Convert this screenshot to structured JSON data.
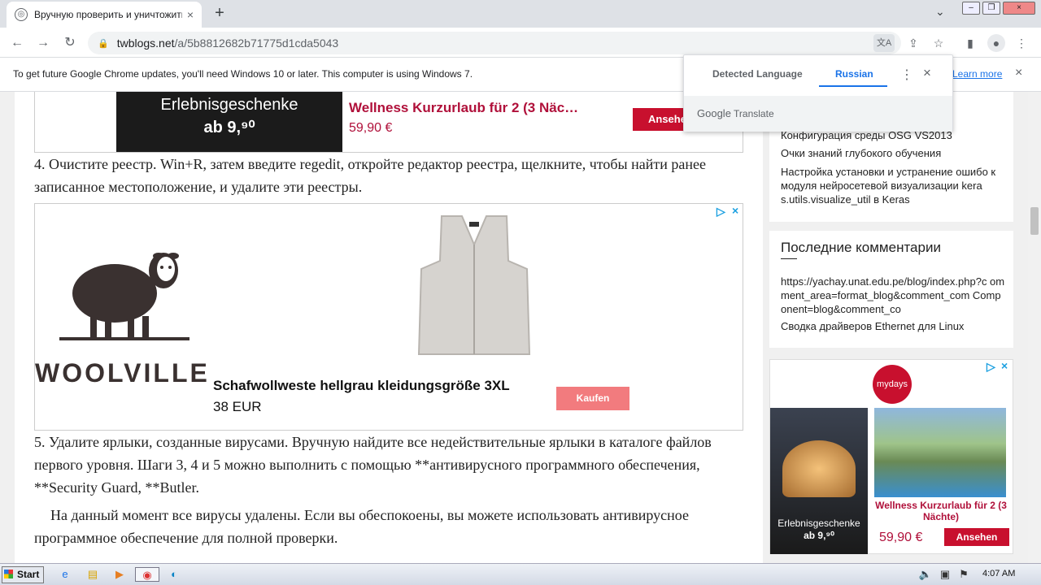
{
  "browser": {
    "tab_title": "Вручную проверить и уничтожить",
    "tab_close": "×",
    "new_tab": "+",
    "tab_search": "⌄",
    "window_buttons": [
      "–",
      "❐",
      "×"
    ],
    "nav": {
      "back": "←",
      "forward": "→",
      "reload": "↻"
    },
    "url_host": "twblogs.net",
    "url_path": "/a/5b8812682b71775d1cda5043",
    "lock": "🔒"
  },
  "infobar": {
    "message": "To get future Google Chrome updates, you'll need Windows 10 or later. This computer is using Windows 7.",
    "learn_more": "Learn more",
    "close": "×"
  },
  "translate_popup": {
    "detected": "Detected Language",
    "russian": "Russian",
    "menu": "⋮",
    "close": "×",
    "footer_google": "Google",
    "footer_translate": " Translate"
  },
  "ad_top": {
    "image_line1": "Erlebnisgeschenke",
    "image_line2": "ab 9,⁹⁰",
    "title": "Wellness Kurzurlaub für 2 (3 Näc…",
    "price": "59,90 €",
    "button": "Ansehen"
  },
  "article": {
    "step4": "4. Очистите реестр. Win+R, затем введите regedit, откройте редактор реестра, щелкните, чтобы найти ранее записанное местоположение, и удалите эти реестры.",
    "step5": "5. Удалите ярлыки, созданные вирусами. Вручную найдите все недействительные ярлыки в каталоге файлов первого уровня. Шаги 3, 4 и 5 можно выполнить с помощью **антивирусного программного обеспечения, **Security Guard, **Butler.",
    "closing": "На данный момент все вирусы удалены. Если вы обеспокоены, вы можете использовать антивирусное программное обеспечение для полной проверки."
  },
  "ad_wool": {
    "brand": "WOOLVILLE",
    "title": "Schafwollweste hellgrau kleidungsgröße 3XL",
    "price": "38 EUR",
    "button": "Kaufen"
  },
  "sidebar": {
    "recent_posts": [
      "Конфигурация среды OSG VS2013",
      "Очки знаний глубокого обучения",
      "Настройка установки и устранение ошибо к модуля нейросетевой визуализации kera s.utils.visualize_util в Keras"
    ],
    "comments_title": "Последние комментарии",
    "comments": [
      "https://yachay.unat.edu.pe/blog/index.php?c omment_area=format_blog&comment_com Component=blog&comment_co",
      "Сводка драйверов Ethernet для Linux"
    ],
    "ad": {
      "logo": "mydays",
      "image_line1": "Erlebnisgeschenke",
      "image_line2": "ab 9,⁹⁰",
      "title": "Wellness Kurzurlaub für 2 (3 Nächte)",
      "price": "59,90 €",
      "button": "Ansehen"
    }
  },
  "taskbar": {
    "start": "Start",
    "clock": "4:07 AM"
  },
  "colors": {
    "ad_red": "#c8102e",
    "ad_title": "#b0103a",
    "wool_button": "#f27b7e",
    "link_blue": "#1a73e8"
  }
}
